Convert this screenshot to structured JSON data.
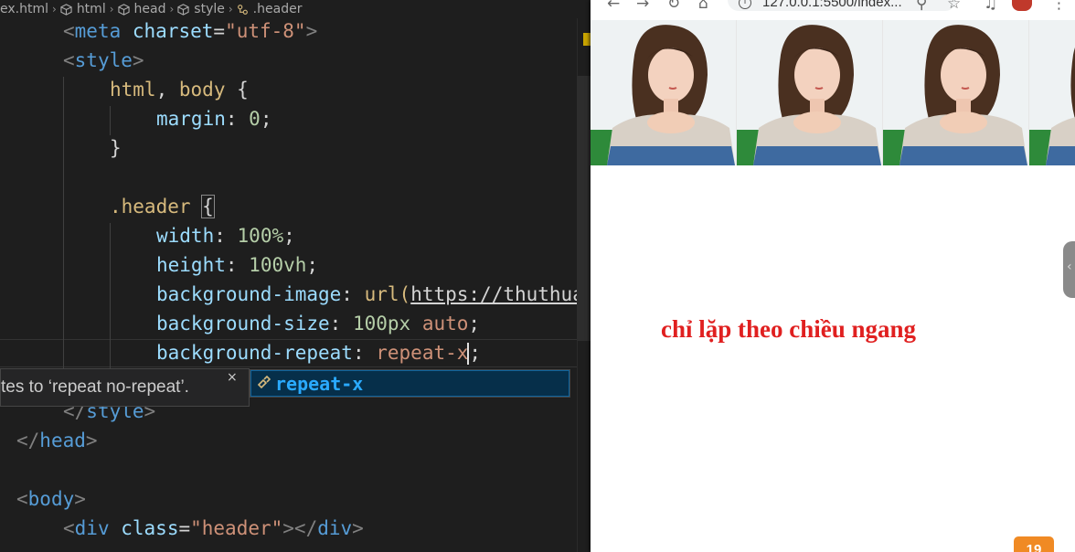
{
  "breadcrumb": {
    "items": [
      "ex.html",
      "html",
      "head",
      "style",
      ".header"
    ]
  },
  "code": {
    "l1": {
      "open": "<",
      "tag": "meta",
      "attr": "charset",
      "eq": "=",
      "val": "\"utf-8\"",
      "close": ">"
    },
    "l2": {
      "open": "<",
      "tag": "style",
      "close": ">"
    },
    "l3": {
      "sel1": "html",
      "comma": ",",
      "sel2": "body",
      "brace": "{"
    },
    "l4": {
      "prop": "margin",
      "colon": ":",
      "num": "0",
      "semi": ";"
    },
    "l5": {
      "brace": "}"
    },
    "l7": {
      "sel": ".header",
      "brace": "{"
    },
    "l8": {
      "prop": "width",
      "colon": ":",
      "num": "100%",
      "semi": ";"
    },
    "l9": {
      "prop": "height",
      "colon": ":",
      "num": "100vh",
      "semi": ";"
    },
    "l10": {
      "prop": "background-image",
      "colon": ":",
      "fn": "url(",
      "url": "https://thuthuat"
    },
    "l11": {
      "prop": "background-size",
      "colon": ":",
      "num": "100px",
      "val": "auto",
      "semi": ";"
    },
    "l12": {
      "prop": "background-repeat",
      "colon": ":",
      "val": "repeat-x",
      "semi": ";"
    },
    "l13": {
      "open": "</",
      "tag": "style",
      "close": ">"
    },
    "l14": {
      "open": "</",
      "tag": "head",
      "close": ">"
    },
    "l16": {
      "open": "<",
      "tag": "body",
      "close": ">"
    },
    "l17": {
      "open": "<",
      "tag": "div",
      "attr": "class",
      "eq": "=",
      "val": "\"header\"",
      "mid": "></",
      "tag2": "div",
      "close": ">"
    }
  },
  "hint": {
    "text": "tes to ‘repeat no-repeat’.",
    "close": "×"
  },
  "suggest": {
    "label": "repeat-x",
    "icon": "property-icon"
  },
  "browser": {
    "nav": {
      "back": "←",
      "forward": "→",
      "reload": "↻",
      "home": "⌂"
    },
    "address": "127.0.0.1:5500/index...",
    "caption": "chỉ lặp theo chiều ngang",
    "tiles": 4,
    "badge": "19",
    "handle": "‹"
  },
  "colors": {
    "editor_bg": "#1e1e1e",
    "tag": "#569cd6",
    "string": "#ce9178",
    "property": "#9cdcfe",
    "number": "#b5cea8",
    "selector": "#d7ba7d",
    "caption": "#e02020",
    "suggest_highlight": "#2aaaff"
  }
}
